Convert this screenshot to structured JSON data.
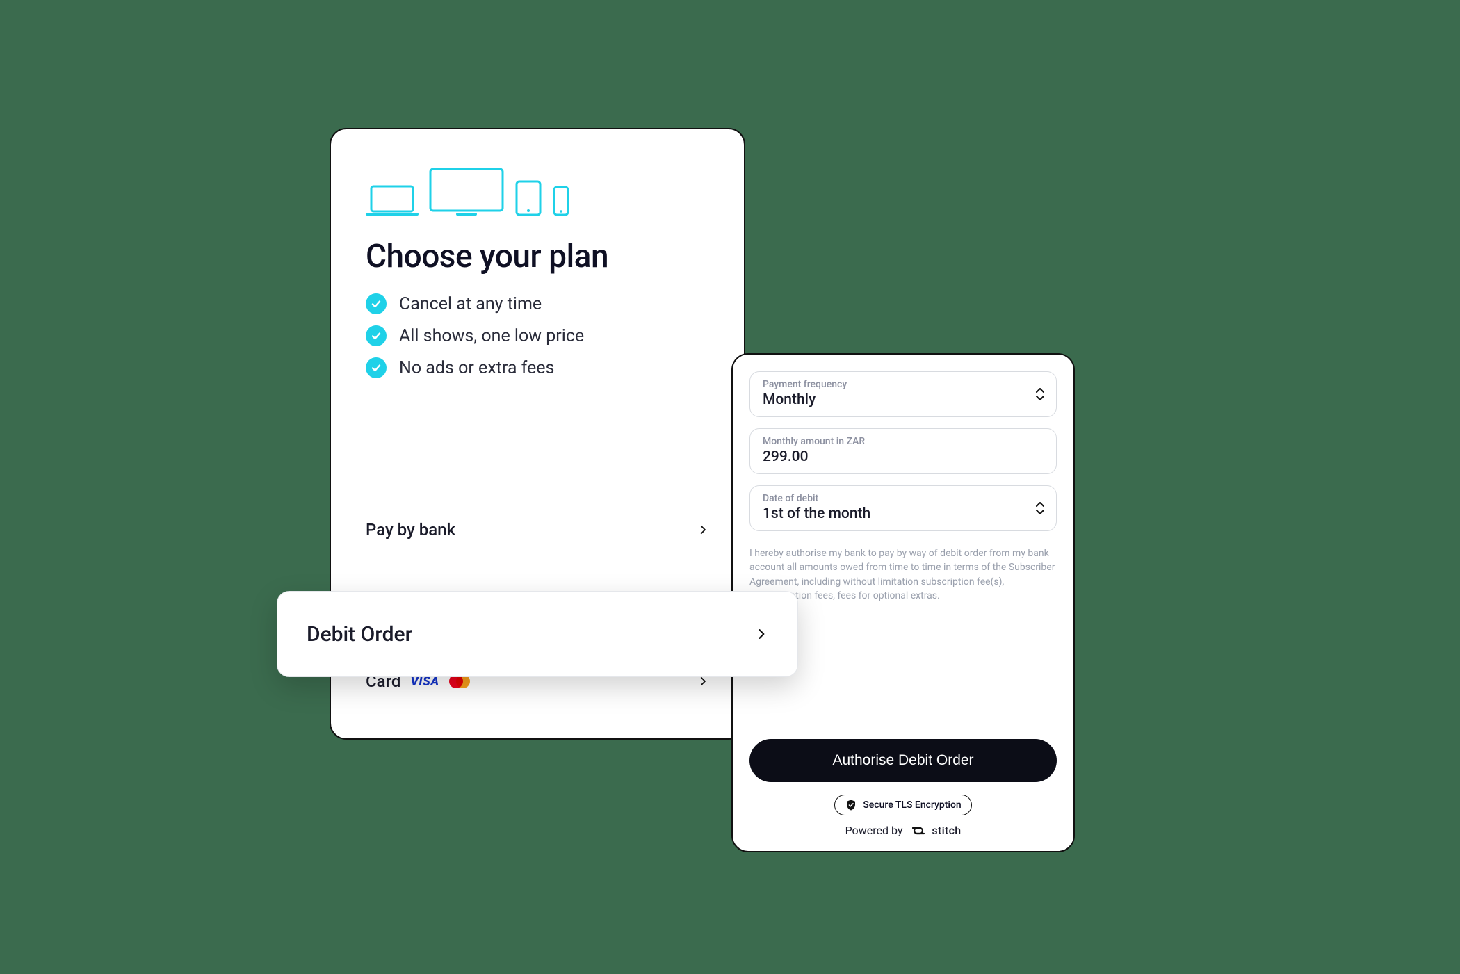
{
  "colors": {
    "background": "#3b6b4e",
    "accent": "#1fd1e8",
    "text": "#0f1024",
    "button": "#0c0d17"
  },
  "plan": {
    "title": "Choose your plan",
    "benefits": [
      "Cancel at any time",
      "All shows, one low price",
      "No ads or extra fees"
    ],
    "icons": [
      "laptop-icon",
      "tv-icon",
      "tablet-icon",
      "phone-icon"
    ],
    "payment_options": {
      "bank": "Pay by bank",
      "debit_order": "Debit Order",
      "card": "Card",
      "card_brands": [
        "VISA",
        "Mastercard"
      ]
    }
  },
  "debit_form": {
    "fields": {
      "frequency": {
        "label": "Payment frequency",
        "value": "Monthly"
      },
      "amount": {
        "label": "Monthly amount in ZAR",
        "value": "299.00"
      },
      "date": {
        "label": "Date of debit",
        "value": "1st of the month"
      }
    },
    "legal_text": "I hereby authorise my bank to pay by way of debit order from my bank account all amounts owed from time to time in terms of the Subscriber Agreement, including without limitation subscription fee(s), administration fees, fees for optional extras.",
    "authorise_label": "Authorise Debit Order",
    "secure_label": "Secure TLS Encryption",
    "powered_by_prefix": "Powered by",
    "powered_by_brand": "stitch"
  }
}
